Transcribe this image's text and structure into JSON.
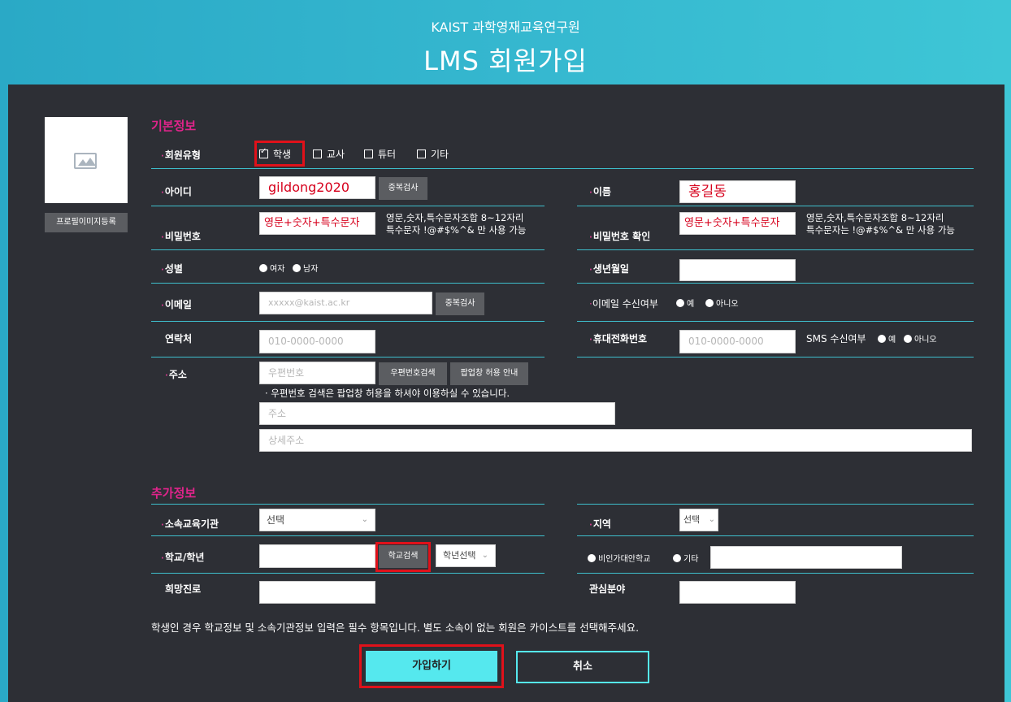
{
  "header": {
    "subtitle": "KAIST 과학영재교육연구원",
    "title": "LMS 회원가입"
  },
  "profile": {
    "button_label": "프로필이미지등록"
  },
  "basic": {
    "section_title": "기본정보",
    "member_type": {
      "label": "회원유형",
      "options": [
        "학생",
        "교사",
        "튜터",
        "기타"
      ],
      "selected": "학생"
    },
    "user_id": {
      "label": "아이디",
      "value": "gildong2020",
      "check_label": "중복검사"
    },
    "name": {
      "label": "이름",
      "value": "홍길동"
    },
    "password": {
      "label": "비밀번호",
      "value": "영문+숫자+특수문자",
      "hint1": "영문,숫자,특수문자조합 8~12자리",
      "hint2": "특수문자 !@#$%^& 만 사용 가능"
    },
    "password_confirm": {
      "label": "비밀번호 확인",
      "value": "영문+숫자+특수문자",
      "hint1": "영문,숫자,특수문자조합 8~12자리",
      "hint2": "특수문자는 !@#$%^& 만 사용 가능"
    },
    "gender": {
      "label": "성별",
      "female": "여자",
      "male": "남자"
    },
    "birthdate": {
      "label": "생년월일",
      "value": ""
    },
    "email": {
      "label": "이메일",
      "placeholder": "xxxxx@kaist.ac.kr",
      "check_label": "중복검사"
    },
    "email_consent": {
      "label": "이메일 수신여부",
      "yes": "예",
      "no": "아니오"
    },
    "phone": {
      "label": "연락처",
      "placeholder": "010-0000-0000"
    },
    "mobile": {
      "label": "휴대전화번호",
      "placeholder": "010-0000-0000"
    },
    "sms_consent": {
      "label": "SMS 수신여부",
      "yes": "예",
      "no": "아니오"
    },
    "address": {
      "label": "주소",
      "zip_placeholder": "우편번호",
      "zip_search_label": "우편번호검색",
      "popup_guide_label": "팝업창 허용 안내",
      "notice": "· 우편번호 검색은 팝업창 허용을 하셔야 이용하실 수 있습니다.",
      "addr_placeholder": "주소",
      "detail_placeholder": "상세주소"
    }
  },
  "extra": {
    "section_title": "추가정보",
    "institution": {
      "label": "소속교육기관",
      "selected": "선택"
    },
    "region": {
      "label": "지역",
      "selected": "선택"
    },
    "school": {
      "label": "학교/학년",
      "search_label": "학교검색",
      "grade_selected": "학년선택"
    },
    "school_type": {
      "option1": "비인가대안학교",
      "option2": "기타"
    },
    "career": {
      "label": "희망진로"
    },
    "interest": {
      "label": "관심분야"
    },
    "notice": "학생인 경우 학교정보 및 소속기관정보 입력은 필수 항목입니다. 별도 소속이 없는 회원은 카이스트를 선택해주세요."
  },
  "actions": {
    "submit_label": "가입하기",
    "cancel_label": "취소"
  },
  "colors": {
    "header_bg": "#35b7cf",
    "panel_bg": "#2d2f35",
    "section_title": "#e0248b",
    "divider": "#3ebfcd",
    "submit_bg": "#55e8ee",
    "highlight": "#e0111a"
  }
}
